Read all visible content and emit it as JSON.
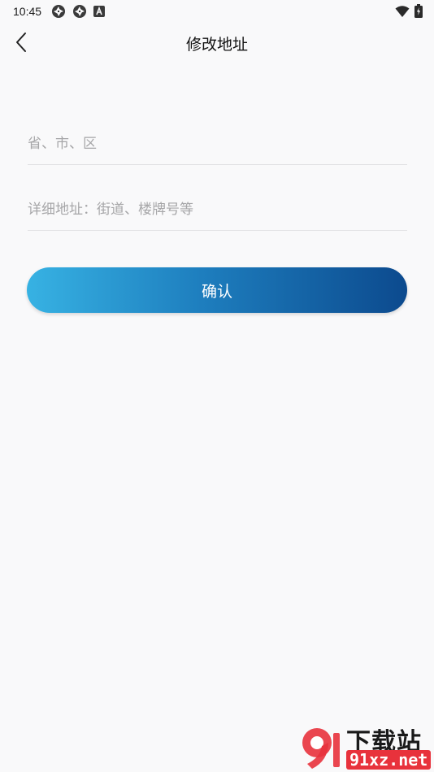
{
  "status_bar": {
    "time": "10:45",
    "icons_left": [
      "app-notification-icon",
      "app-notification-icon",
      "font-a-icon"
    ],
    "icons_right": [
      "wifi-icon",
      "battery-icon"
    ]
  },
  "nav": {
    "title": "修改地址",
    "back_icon": "chevron-left-icon"
  },
  "form": {
    "region_placeholder": "省、市、区",
    "region_value": "",
    "detail_placeholder": "详细地址：街道、楼牌号等",
    "detail_value": "",
    "confirm_label": "确认"
  },
  "watermark": {
    "logo_text": "9f",
    "top_text": "下载站",
    "bottom_text": "91xz.net"
  },
  "colors": {
    "background": "#f9f9fa",
    "button_gradient_start": "#37b2e3",
    "button_gradient_end": "#0c4a8e",
    "placeholder": "#a6a6a8",
    "divider": "#e2e2e4"
  }
}
